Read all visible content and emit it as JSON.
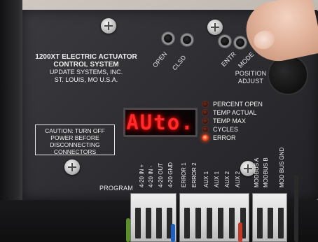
{
  "panel": {
    "title_line1": "1200XT ELECTRIC ACTUATOR",
    "title_line2": "CONTROL SYSTEM",
    "company": "UPDATE SYSTEMS, INC.",
    "location": "ST. LOUIS, MO  U.S.A."
  },
  "buttons": {
    "open": "OPEN",
    "clsd": "CLSD",
    "entr": "ENTR",
    "mode": "MODE"
  },
  "knob": {
    "label_line1": "POSITION",
    "label_line2": "ADJUST"
  },
  "display": {
    "text": "AUto."
  },
  "indicators": [
    {
      "label": "PERCENT OPEN",
      "state": "off"
    },
    {
      "label": "TEMP ACTUAL",
      "state": "off"
    },
    {
      "label": "TEMP MAX",
      "state": "off"
    },
    {
      "label": "CYCLES",
      "state": "off"
    },
    {
      "label": "ERROR",
      "state": "on"
    }
  ],
  "caution": {
    "line1": "CAUTION: TURN OFF",
    "line2": "POWER BEFORE",
    "line3": "DISCONNECTING",
    "line4": "CONNECTORS"
  },
  "terminals": {
    "program": "PROGRAM",
    "labels": [
      "4-20 IN +",
      "4-20 IN -",
      "4-20 OUT",
      "4-20 GND",
      "ERROR 1",
      "ERROR 2",
      "AUX 1",
      "AUX 1",
      "AUX 2",
      "AUX 2",
      "MODBUS A",
      "MODBUS B",
      "MOD BUS GND"
    ]
  },
  "colors": {
    "display_red": "#ff2b2b",
    "led_on": "#ff5a2c",
    "panel": "#2c2c31"
  }
}
